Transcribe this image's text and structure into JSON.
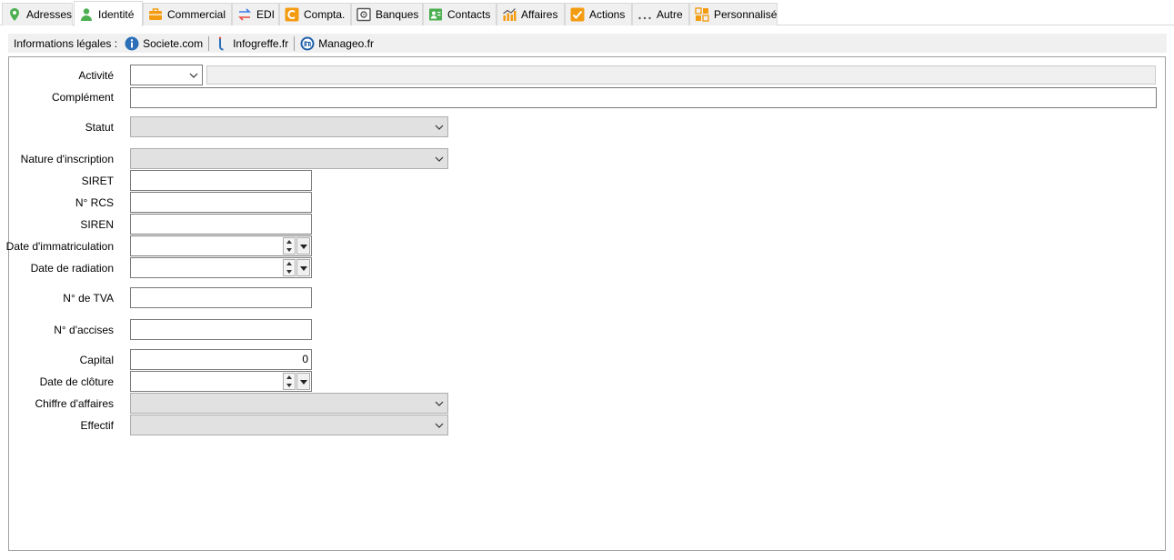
{
  "tabs": [
    {
      "label": "Adresses",
      "icon": "map-pin-icon",
      "color": "#4caf50"
    },
    {
      "label": "Identité",
      "icon": "person-icon",
      "color": "#4caf50",
      "active": true
    },
    {
      "label": "Commercial",
      "icon": "briefcase-icon",
      "color": "#f39c12"
    },
    {
      "label": "EDI",
      "icon": "exchange-arrows-icon",
      "color": "#e74c3c"
    },
    {
      "label": "Compta.",
      "icon": "accounting-icon",
      "color": "#f39c12"
    },
    {
      "label": "Banques",
      "icon": "safe-icon",
      "color": "#555555"
    },
    {
      "label": "Contacts",
      "icon": "contact-card-icon",
      "color": "#4caf50"
    },
    {
      "label": "Affaires",
      "icon": "bar-chart-icon",
      "color": "#f39c12"
    },
    {
      "label": "Actions",
      "icon": "checkmark-icon",
      "color": "#f39c12"
    },
    {
      "label": "Autre",
      "icon": "ellipsis-icon",
      "color": "#555555"
    },
    {
      "label": "Personnalisé",
      "icon": "custom-grid-icon",
      "color": "#f39c12"
    }
  ],
  "legal": {
    "label": "Informations légales :",
    "links": [
      {
        "label": "Societe.com",
        "icon": "info-circle-icon"
      },
      {
        "label": "Infogreffe.fr",
        "icon": "infogreffe-icon"
      },
      {
        "label": "Manageo.fr",
        "icon": "manageo-icon"
      }
    ]
  },
  "form": {
    "activite": {
      "label": "Activité",
      "value": "",
      "detail": ""
    },
    "complement": {
      "label": "Complément",
      "value": ""
    },
    "statut": {
      "label": "Statut",
      "value": ""
    },
    "nature": {
      "label": "Nature d'inscription",
      "value": ""
    },
    "siret": {
      "label": "SIRET",
      "value": ""
    },
    "rcs": {
      "label": "N° RCS",
      "value": ""
    },
    "siren": {
      "label": "SIREN",
      "value": ""
    },
    "date_immat": {
      "label": "Date d'immatriculation",
      "value": ""
    },
    "date_radiation": {
      "label": "Date de radiation",
      "value": ""
    },
    "tva": {
      "label": "N° de TVA",
      "value": ""
    },
    "accises": {
      "label": "N° d'accises",
      "value": ""
    },
    "capital": {
      "label": "Capital",
      "value": "0"
    },
    "date_cloture": {
      "label": "Date de clôture",
      "value": ""
    },
    "ca": {
      "label": "Chiffre d'affaires",
      "value": ""
    },
    "effectif": {
      "label": "Effectif",
      "value": ""
    }
  }
}
